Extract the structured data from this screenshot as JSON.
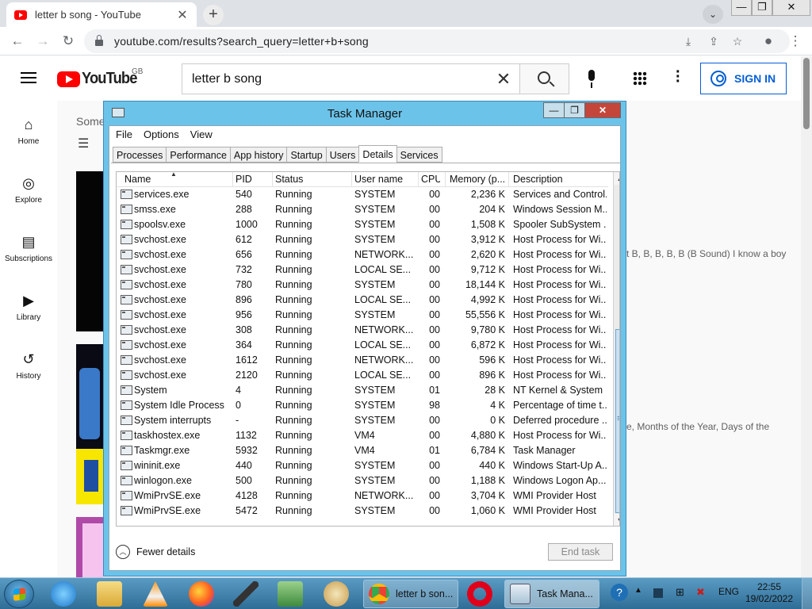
{
  "browser": {
    "tab_title": "letter b song - YouTube",
    "url": "youtube.com/results?search_query=letter+b+song",
    "close_glyph": "✕",
    "new_tab_glyph": "+",
    "back_glyph": "←",
    "forward_glyph": "→",
    "reload_glyph": "↻"
  },
  "window_controls": {
    "minimize": "—",
    "restore": "❐",
    "close": "✕"
  },
  "youtube": {
    "logo_text": "YouTube",
    "country": "GB",
    "search_value": "letter b song",
    "clear_glyph": "✕",
    "sign_in": "SIGN IN",
    "sidebar": [
      {
        "label": "Home",
        "icon": "home-icon",
        "glyph": "⌂"
      },
      {
        "label": "Explore",
        "icon": "compass-icon",
        "glyph": "◎"
      },
      {
        "label": "Subscriptions",
        "icon": "subscriptions-icon",
        "glyph": "▤"
      },
      {
        "label": "Library",
        "icon": "library-icon",
        "glyph": "▶"
      },
      {
        "label": "History",
        "icon": "history-icon",
        "glyph": "↺"
      }
    ],
    "main_partial": "Some",
    "result_snippet_1": "t B, B, B, B, B (B Sound) I know a boy",
    "result_snippet_2": "e, Months of the Year, Days of the"
  },
  "task_manager": {
    "title": "Task Manager",
    "menu": [
      "File",
      "Options",
      "View"
    ],
    "tabs": [
      "Processes",
      "Performance",
      "App history",
      "Startup",
      "Users",
      "Details",
      "Services"
    ],
    "active_tab": "Details",
    "columns": [
      "Name",
      "PID",
      "Status",
      "User name",
      "CPU",
      "Memory (p...",
      "Description"
    ],
    "rows": [
      [
        "services.exe",
        "540",
        "Running",
        "SYSTEM",
        "00",
        "2,236 K",
        "Services and Control..."
      ],
      [
        "smss.exe",
        "288",
        "Running",
        "SYSTEM",
        "00",
        "204 K",
        "Windows Session M..."
      ],
      [
        "spoolsv.exe",
        "1000",
        "Running",
        "SYSTEM",
        "00",
        "1,508 K",
        "Spooler SubSystem ..."
      ],
      [
        "svchost.exe",
        "612",
        "Running",
        "SYSTEM",
        "00",
        "3,912 K",
        "Host Process for Wi..."
      ],
      [
        "svchost.exe",
        "656",
        "Running",
        "NETWORK...",
        "00",
        "2,620 K",
        "Host Process for Wi..."
      ],
      [
        "svchost.exe",
        "732",
        "Running",
        "LOCAL SE...",
        "00",
        "9,712 K",
        "Host Process for Wi..."
      ],
      [
        "svchost.exe",
        "780",
        "Running",
        "SYSTEM",
        "00",
        "18,144 K",
        "Host Process for Wi..."
      ],
      [
        "svchost.exe",
        "896",
        "Running",
        "LOCAL SE...",
        "00",
        "4,992 K",
        "Host Process for Wi..."
      ],
      [
        "svchost.exe",
        "956",
        "Running",
        "SYSTEM",
        "00",
        "55,556 K",
        "Host Process for Wi..."
      ],
      [
        "svchost.exe",
        "308",
        "Running",
        "NETWORK...",
        "00",
        "9,780 K",
        "Host Process for Wi..."
      ],
      [
        "svchost.exe",
        "364",
        "Running",
        "LOCAL SE...",
        "00",
        "6,872 K",
        "Host Process for Wi..."
      ],
      [
        "svchost.exe",
        "1612",
        "Running",
        "NETWORK...",
        "00",
        "596 K",
        "Host Process for Wi..."
      ],
      [
        "svchost.exe",
        "2120",
        "Running",
        "LOCAL SE...",
        "00",
        "896 K",
        "Host Process for Wi..."
      ],
      [
        "System",
        "4",
        "Running",
        "SYSTEM",
        "01",
        "28 K",
        "NT Kernel & System"
      ],
      [
        "System Idle Process",
        "0",
        "Running",
        "SYSTEM",
        "98",
        "4 K",
        "Percentage of time t..."
      ],
      [
        "System interrupts",
        "-",
        "Running",
        "SYSTEM",
        "00",
        "0 K",
        "Deferred procedure ..."
      ],
      [
        "taskhostex.exe",
        "1132",
        "Running",
        "VM4",
        "00",
        "4,880 K",
        "Host Process for Wi..."
      ],
      [
        "Taskmgr.exe",
        "5932",
        "Running",
        "VM4",
        "01",
        "6,784 K",
        "Task Manager"
      ],
      [
        "wininit.exe",
        "440",
        "Running",
        "SYSTEM",
        "00",
        "440 K",
        "Windows Start-Up A..."
      ],
      [
        "winlogon.exe",
        "500",
        "Running",
        "SYSTEM",
        "00",
        "1,188 K",
        "Windows Logon Ap..."
      ],
      [
        "WmiPrvSE.exe",
        "4128",
        "Running",
        "NETWORK...",
        "00",
        "3,704 K",
        "WMI Provider Host"
      ],
      [
        "WmiPrvSE.exe",
        "5472",
        "Running",
        "SYSTEM",
        "00",
        "1,060 K",
        "WMI Provider Host"
      ]
    ],
    "fewer_details": "Fewer details",
    "end_task": "End task"
  },
  "taskbar": {
    "tasks": [
      {
        "label": "letter b son...",
        "icon": "chrome-icon"
      },
      {
        "label": "Task Mana...",
        "icon": "task-manager-icon"
      }
    ],
    "language": "ENG",
    "time": "22:55",
    "date": "19/02/2022"
  }
}
